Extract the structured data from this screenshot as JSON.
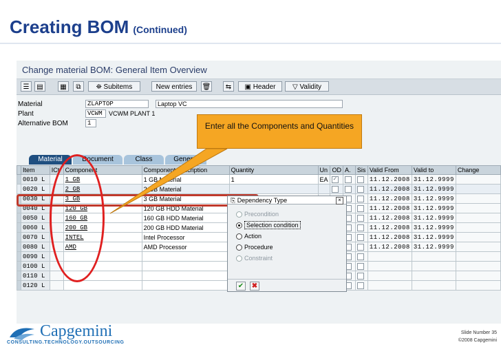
{
  "slide": {
    "title": "Creating BOM",
    "subtitle": "(Continued)",
    "slide_number": "Slide Number 35",
    "copyright": "©2008 Capgemini",
    "logo_name": "Capgemini",
    "logo_tagline": "CONSULTING.TECHNOLOGY.OUTSOURCING"
  },
  "sap": {
    "screen_title": "Change material BOM: General Item Overview",
    "toolbar": {
      "subitems": "Subitems",
      "new_entries": "New entries",
      "header": "Header",
      "validity": "Validity"
    },
    "header_fields": {
      "material_label": "Material",
      "material_value": "ZLAPTOP",
      "material_desc": "Laptop VC",
      "plant_label": "Plant",
      "plant_value": "VCWM",
      "plant_desc": "VCWM PLANT 1",
      "alt_bom_label": "Alternative BOM",
      "alt_bom_value": "1"
    },
    "tabs": [
      "Material",
      "Document",
      "Class",
      "General"
    ],
    "columns": [
      "Item",
      "ICt",
      "Component",
      "Component description",
      "Quantity",
      "Un",
      "OD",
      "A.",
      "Sis",
      "Valid From",
      "Valid to",
      "Change"
    ],
    "rows": [
      {
        "item": "0010",
        "ict": "L",
        "component": "1 GB",
        "desc": "1 GB Material",
        "qty": "1",
        "un": "EA",
        "valid_from": "11.12.2008",
        "valid_to": "31.12.9999"
      },
      {
        "item": "0020",
        "ict": "L",
        "component": "2 GB",
        "desc": "2 GB Material",
        "qty": "",
        "un": "",
        "valid_from": "11.12.2008",
        "valid_to": "31.12.9999"
      },
      {
        "item": "0030",
        "ict": "L",
        "component": "3 GB",
        "desc": "3 GB Material",
        "qty": "",
        "un": "",
        "valid_from": "11.12.2008",
        "valid_to": "31.12.9999"
      },
      {
        "item": "0040",
        "ict": "L",
        "component": "120 GB",
        "desc": "120 GB HDD  Material",
        "qty": "",
        "un": "",
        "valid_from": "11.12.2008",
        "valid_to": "31.12.9999"
      },
      {
        "item": "0050",
        "ict": "L",
        "component": "160 GB",
        "desc": "160 GB HDD  Material",
        "qty": "",
        "un": "",
        "valid_from": "11.12.2008",
        "valid_to": "31.12.9999"
      },
      {
        "item": "0060",
        "ict": "L",
        "component": "200 GB",
        "desc": "200 GB HDD  Material",
        "qty": "",
        "un": "",
        "valid_from": "11.12.2008",
        "valid_to": "31.12.9999"
      },
      {
        "item": "0070",
        "ict": "L",
        "component": "INTEL",
        "desc": "Intel Processor",
        "qty": "",
        "un": "",
        "valid_from": "11.12.2008",
        "valid_to": "31.12.9999"
      },
      {
        "item": "0080",
        "ict": "L",
        "component": "AMD",
        "desc": "AMD Processor",
        "qty": "",
        "un": "",
        "valid_from": "11.12.2008",
        "valid_to": "31.12.9999"
      },
      {
        "item": "0090",
        "ict": "L",
        "component": "",
        "desc": "",
        "qty": "",
        "un": "",
        "valid_from": "",
        "valid_to": ""
      },
      {
        "item": "0100",
        "ict": "L",
        "component": "",
        "desc": "",
        "qty": "",
        "un": "",
        "valid_from": "",
        "valid_to": ""
      },
      {
        "item": "0110",
        "ict": "L",
        "component": "",
        "desc": "",
        "qty": "",
        "un": "",
        "valid_from": "",
        "valid_to": ""
      },
      {
        "item": "0120",
        "ict": "L",
        "component": "",
        "desc": "",
        "qty": "",
        "un": "",
        "valid_from": "",
        "valid_to": ""
      }
    ]
  },
  "callout": {
    "text": "Enter all the Components and Quantities"
  },
  "dependency_dialog": {
    "title": "Dependency Type",
    "options": [
      {
        "label": "Precondition",
        "state": "disabled"
      },
      {
        "label": "Selection condition",
        "state": "selected"
      },
      {
        "label": "Action",
        "state": "enabled"
      },
      {
        "label": "Procedure",
        "state": "enabled"
      },
      {
        "label": "Constraint",
        "state": "disabled"
      }
    ]
  },
  "colors": {
    "title_blue": "#1c3f8c",
    "callout_orange": "#f5a623",
    "annotation_red": "#e02020",
    "brand_blue": "#1f6fb5"
  }
}
